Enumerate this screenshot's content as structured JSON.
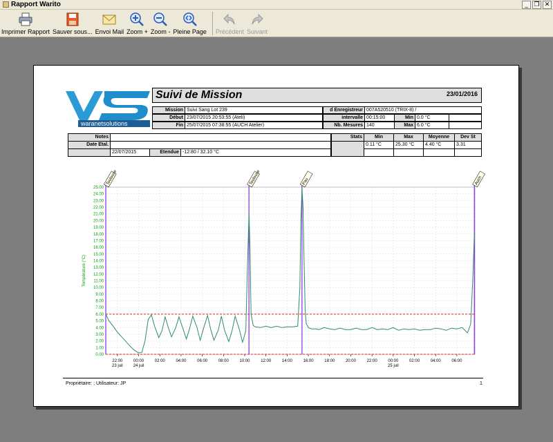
{
  "window": {
    "title": "Rapport Warito"
  },
  "toolbar": {
    "print": "Imprimer Rapport",
    "save": "Sauver sous...",
    "mail": "Envoi Mail",
    "zoom_in": "Zoom +",
    "zoom_out": "Zoom -",
    "full_page": "Pleine Page",
    "previous": "Précédent",
    "next": "Suivant"
  },
  "report": {
    "logo_text": "waranetsolutions",
    "title": "Suivi de Mission",
    "date": "23/01/2016",
    "mission_label": "Mission",
    "mission_value": "Suivi Sang Lot 239",
    "debut_label": "Début",
    "debut_value": "23/07/2015  20:53:55 (Ateli)",
    "fin_label": "Fin",
    "fin_value": "25/07/2015  07:38:55 (AUCH Atelier)",
    "enregistreur_label": "d Enregistreur",
    "enregistreur_value": "007A520510 (TRIX-8) /",
    "intervalle_label": "intervalle",
    "intervalle_value": "00:15:00",
    "nb_mesures_label": "Nb. Mesures",
    "nb_mesures_value": "140",
    "min_label": "Min",
    "min_value": "0.0 °C",
    "max_label": "Max",
    "max_value": "6.0 °C",
    "notes_label": "Notes",
    "date_etal_label": "Date Etal.",
    "date_etal_value": "22/07/2015",
    "etendue_label": "Etendue",
    "etendue_value": "-12.80 / 32.10 °C",
    "stats_label": "Stats",
    "stats_headers": [
      "Min",
      "Max",
      "Moyenne",
      "Dev St"
    ],
    "stats_values": [
      "0.11 °C",
      "25.30 °C",
      "4.40 °C",
      "3.31"
    ],
    "footer_text": "Propriétaire: ;   Utilisateur: JP",
    "page_number": "1"
  },
  "colors": {
    "series": "#2e8b6e",
    "limit": "#e02020",
    "marker": "#8a2be2",
    "axis_label": "#00a000"
  },
  "chart_data": {
    "type": "line",
    "ylabel": "Température (°C)",
    "ylim": [
      0,
      25
    ],
    "yticks": [
      "0.00",
      "1.00",
      "2.00",
      "3.00",
      "4.00",
      "5.00",
      "6.00",
      "7.00",
      "8.00",
      "9.00",
      "10.00",
      "11.00",
      "12.00",
      "13.00",
      "14.00",
      "15.00",
      "16.00",
      "17.00",
      "18.00",
      "19.00",
      "20.00",
      "21.00",
      "22.00",
      "23.00",
      "24.00",
      "25.00"
    ],
    "xlim_hours": [
      -3.1,
      31.7
    ],
    "xticks": [
      {
        "h": -2,
        "label": "22:00",
        "sub": "23 juil"
      },
      {
        "h": 0,
        "label": "00:00",
        "sub": "24 juil"
      },
      {
        "h": 2,
        "label": "02:00",
        "sub": ""
      },
      {
        "h": 4,
        "label": "04:00",
        "sub": ""
      },
      {
        "h": 6,
        "label": "06:00",
        "sub": ""
      },
      {
        "h": 8,
        "label": "08:00",
        "sub": ""
      },
      {
        "h": 10,
        "label": "10:00",
        "sub": ""
      },
      {
        "h": 12,
        "label": "12:00",
        "sub": ""
      },
      {
        "h": 14,
        "label": "14:00",
        "sub": ""
      },
      {
        "h": 16,
        "label": "16:00",
        "sub": ""
      },
      {
        "h": 18,
        "label": "18:00",
        "sub": ""
      },
      {
        "h": 20,
        "label": "20:00",
        "sub": ""
      },
      {
        "h": 22,
        "label": "22:00",
        "sub": ""
      },
      {
        "h": 24,
        "label": "00:00",
        "sub": "25 juil"
      },
      {
        "h": 26,
        "label": "02:00",
        "sub": ""
      },
      {
        "h": 28,
        "label": "04:00",
        "sub": ""
      },
      {
        "h": 30,
        "label": "06:00",
        "sub": ""
      }
    ],
    "limits": [
      0.0,
      6.0
    ],
    "events": [
      {
        "h": -3.1,
        "label": "Toulouse"
      },
      {
        "h": 10.4,
        "label": "Toulouse"
      },
      {
        "h": 15.4,
        "label": "Pau"
      },
      {
        "h": 31.65,
        "label": "Auch"
      }
    ],
    "series": [
      {
        "x": [
          -3.1,
          -2.8,
          -2.4,
          -2.0,
          -1.6,
          -1.2,
          -0.8,
          -0.4,
          0.0,
          0.3,
          0.6,
          0.9,
          1.2,
          1.5,
          1.9,
          2.2,
          2.5,
          2.8,
          3.1,
          3.5,
          3.8,
          4.1,
          4.5,
          4.8,
          5.1,
          5.5,
          5.8,
          6.1,
          6.5,
          6.8,
          7.1,
          7.5,
          7.8,
          8.1,
          8.5,
          8.8,
          9.1,
          9.5,
          9.8,
          10.1,
          10.25,
          10.4,
          10.5,
          10.6,
          10.8,
          11.0,
          11.5,
          12.0,
          12.5,
          13.0,
          13.5,
          14.0,
          14.5,
          15.0,
          15.2,
          15.3,
          15.4,
          15.5,
          15.6,
          15.7,
          15.8,
          16.0,
          16.3,
          16.7,
          17.0,
          17.5,
          18.0,
          18.5,
          19.0,
          19.5,
          20.0,
          20.5,
          21.0,
          21.5,
          22.0,
          22.5,
          23.0,
          23.5,
          24.0,
          24.5,
          25.0,
          25.5,
          26.0,
          26.5,
          27.0,
          27.5,
          28.0,
          28.5,
          29.0,
          29.5,
          30.0,
          30.5,
          31.0,
          31.3,
          31.5,
          31.65
        ],
        "y": [
          6.0,
          5.0,
          4.2,
          3.3,
          2.6,
          1.9,
          1.2,
          0.6,
          0.2,
          0.3,
          2.0,
          5.2,
          5.9,
          4.2,
          2.5,
          3.5,
          5.6,
          4.0,
          2.6,
          4.0,
          5.6,
          4.2,
          2.3,
          3.8,
          5.7,
          4.0,
          2.1,
          3.8,
          5.8,
          3.7,
          2.1,
          3.6,
          5.7,
          3.6,
          1.9,
          3.5,
          5.7,
          3.7,
          1.8,
          3.5,
          13.0,
          21.0,
          16.0,
          6.0,
          4.3,
          4.1,
          4.0,
          4.2,
          4.0,
          4.2,
          4.0,
          4.1,
          4.1,
          4.2,
          10.0,
          20.0,
          24.8,
          22.0,
          14.0,
          6.5,
          4.6,
          4.0,
          3.8,
          3.8,
          3.7,
          4.0,
          3.8,
          3.7,
          3.9,
          3.7,
          3.7,
          3.9,
          3.7,
          3.7,
          4.0,
          3.7,
          3.8,
          3.7,
          4.0,
          3.6,
          3.8,
          3.7,
          3.8,
          3.6,
          3.7,
          3.7,
          3.9,
          3.8,
          3.6,
          3.9,
          3.8,
          4.0,
          3.2,
          4.5,
          11.0,
          18.0
        ]
      }
    ]
  }
}
